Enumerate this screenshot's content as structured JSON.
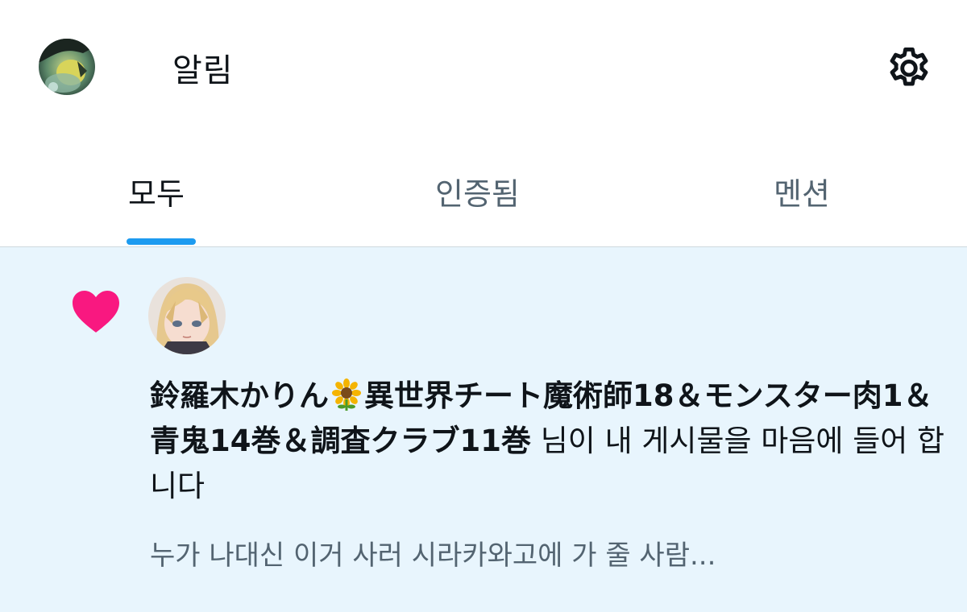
{
  "header": {
    "title": "알림",
    "avatar_icon": "avatar-icon",
    "settings_icon": "gear-icon"
  },
  "tabs": [
    {
      "label": "모두",
      "active": true
    },
    {
      "label": "인증됨",
      "active": false
    },
    {
      "label": "멘션",
      "active": false
    }
  ],
  "notification": {
    "type_icon": "heart-icon",
    "user_name_part1": "鈴羅木かりん",
    "user_name_emoji": "sunflower-icon",
    "user_name_part2": "異世界チート魔術師18＆モンスター肉1＆青鬼14巻＆調査クラブ11巻",
    "action_text": " 님이 내 게시물을 마음에 들어 합니다",
    "post_preview": "누가 나대신 이거 사러 시라카와고에 가 줄 사람..."
  },
  "colors": {
    "accent": "#1d9bf0",
    "heart": "#f91880",
    "unread_background": "#e8f5fd",
    "secondary_text": "#536471",
    "divider": "#cfd9de"
  }
}
